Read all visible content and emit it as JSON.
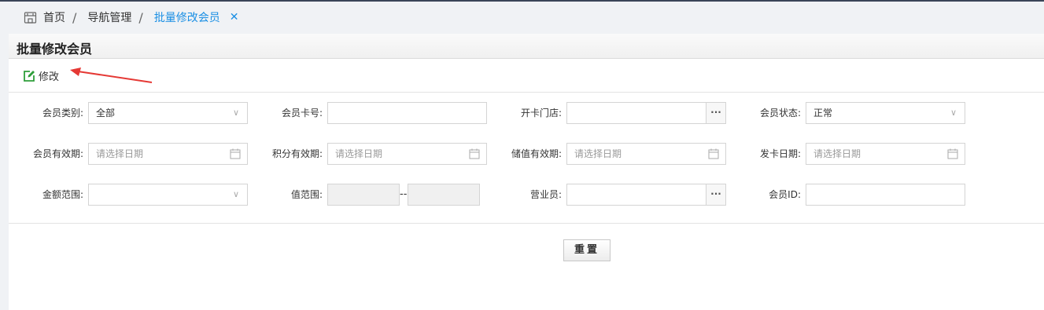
{
  "breadcrumb": {
    "home": "首页",
    "nav": "导航管理",
    "current": "批量修改会员",
    "sep": "/",
    "close": "✕"
  },
  "panel": {
    "title": "批量修改会员",
    "edit_label": "修改"
  },
  "form": {
    "member_type": {
      "label": "会员类别:",
      "value": "全部"
    },
    "card_no": {
      "label": "会员卡号:",
      "value": ""
    },
    "store": {
      "label": "开卡门店:",
      "value": "",
      "button": "···"
    },
    "status": {
      "label": "会员状态:",
      "value": "正常"
    },
    "member_valid": {
      "label": "会员有效期:",
      "placeholder": "请选择日期"
    },
    "points_valid": {
      "label": "积分有效期:",
      "placeholder": "请选择日期"
    },
    "stored_valid": {
      "label": "储值有效期:",
      "placeholder": "请选择日期"
    },
    "issue_date": {
      "label": "发卡日期:",
      "placeholder": "请选择日期"
    },
    "amount_range": {
      "label": "金额范围:",
      "value": ""
    },
    "value_range": {
      "label": "值范围:",
      "dash": "--"
    },
    "salesman": {
      "label": "营业员:",
      "value": "",
      "button": "···"
    },
    "member_id": {
      "label": "会员ID:",
      "value": ""
    }
  },
  "reset_label": "重置",
  "colors": {
    "accent": "#1a8fe4",
    "edit_icon": "#2e9e3a",
    "arrow": "#e53935"
  }
}
